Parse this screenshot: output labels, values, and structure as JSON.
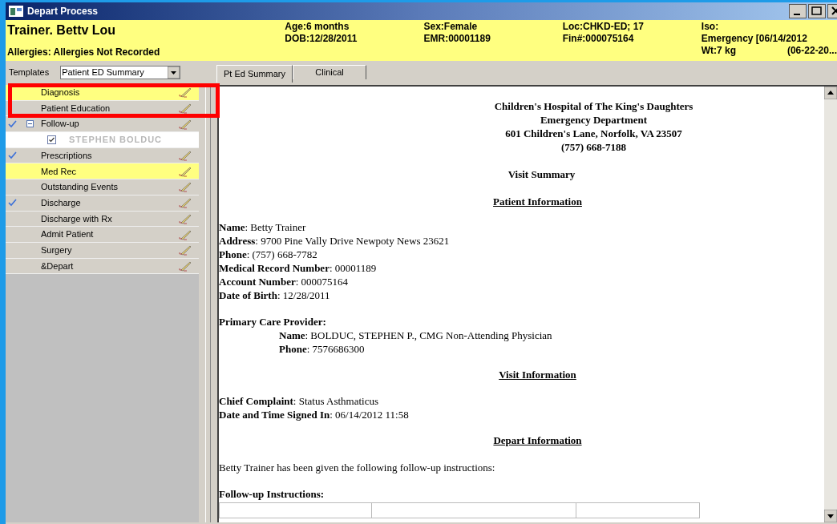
{
  "window": {
    "title": "Depart Process"
  },
  "banner": {
    "patient_name": "Trainer. Bettv Lou",
    "allergies": "Allergies: Allergies Not Recorded",
    "columns": [
      [
        "Age:6 months",
        "DOB:12/28/2011"
      ],
      [
        "Sex:Female",
        "EMR:00001189"
      ],
      [
        "Loc:CHKD-ED; 17",
        "Fin#:000075164"
      ],
      [
        "Iso:",
        "Emergency [06/14/2012"
      ]
    ],
    "weight": "Wt:7 kg",
    "date_range": "(06-22-20..."
  },
  "templates": {
    "label": "Templates",
    "value": "Patient ED Summary"
  },
  "tabs": [
    {
      "label": "Pt Ed Summary",
      "selected": true
    },
    {
      "label": "Clinical",
      "selected": false
    }
  ],
  "sidebar": {
    "items": [
      {
        "label": "Diagnosis",
        "checked": false,
        "highlighted": true
      },
      {
        "label": "Patient Education",
        "checked": false,
        "highlighted": false
      },
      {
        "label": "Follow-up",
        "checked": true,
        "highlighted": false,
        "expanded": true,
        "children": [
          {
            "label": "STEPHEN BOLDUC",
            "checked": true
          }
        ]
      },
      {
        "label": "Prescriptions",
        "checked": true,
        "highlighted": false
      },
      {
        "label": "Med Rec",
        "checked": false,
        "highlighted": true
      },
      {
        "label": "Outstanding Events",
        "checked": false,
        "highlighted": false
      },
      {
        "label": "Discharge",
        "checked": true,
        "highlighted": false
      },
      {
        "label": "Discharge with Rx",
        "checked": false,
        "highlighted": false
      },
      {
        "label": "Admit Patient",
        "checked": false,
        "highlighted": false
      },
      {
        "label": "Surgery",
        "checked": false,
        "highlighted": false
      },
      {
        "label": "&Depart",
        "checked": false,
        "highlighted": false
      }
    ]
  },
  "document": {
    "blocks": [
      {
        "kind": "heading",
        "lines": [
          "Children's Hospital of The King's Daughters",
          "Emergency Department",
          "601 Children's Lane, Norfolk, VA  23507",
          "(757) 668-7188"
        ]
      },
      {
        "kind": "title",
        "text": "Visit Summary"
      },
      {
        "kind": "section",
        "text": "Patient Information"
      },
      {
        "kind": "fields",
        "lines": [
          "**Name**: Betty Trainer",
          "**Address**: 9700 Pine Vally Drive Newpoty News  23621",
          "**Phone**: (757) 668-7782",
          "**Medical Record Number**: 00001189",
          "**Account Number**: 000075164",
          "**Date of Birth**: 12/28/2011"
        ]
      },
      {
        "kind": "label",
        "text": "Primary Care Provider:"
      },
      {
        "kind": "indented",
        "lines": [
          "**Name**: BOLDUC, STEPHEN P., CMG Non-Attending Physician",
          "**Phone**: 7576686300"
        ]
      },
      {
        "kind": "section",
        "text": "Visit Information"
      },
      {
        "kind": "fields",
        "lines": [
          "**Chief Complaint**: Status Asthmaticus",
          "**Date and Time Signed In**: 06/14/2012 11:58"
        ]
      },
      {
        "kind": "section",
        "text": "Depart Information"
      },
      {
        "kind": "paragraph",
        "text": "Betty Trainer has been given the following follow-up instructions:"
      },
      {
        "kind": "label",
        "text": "Follow-up Instructions:"
      },
      {
        "kind": "table"
      }
    ]
  }
}
